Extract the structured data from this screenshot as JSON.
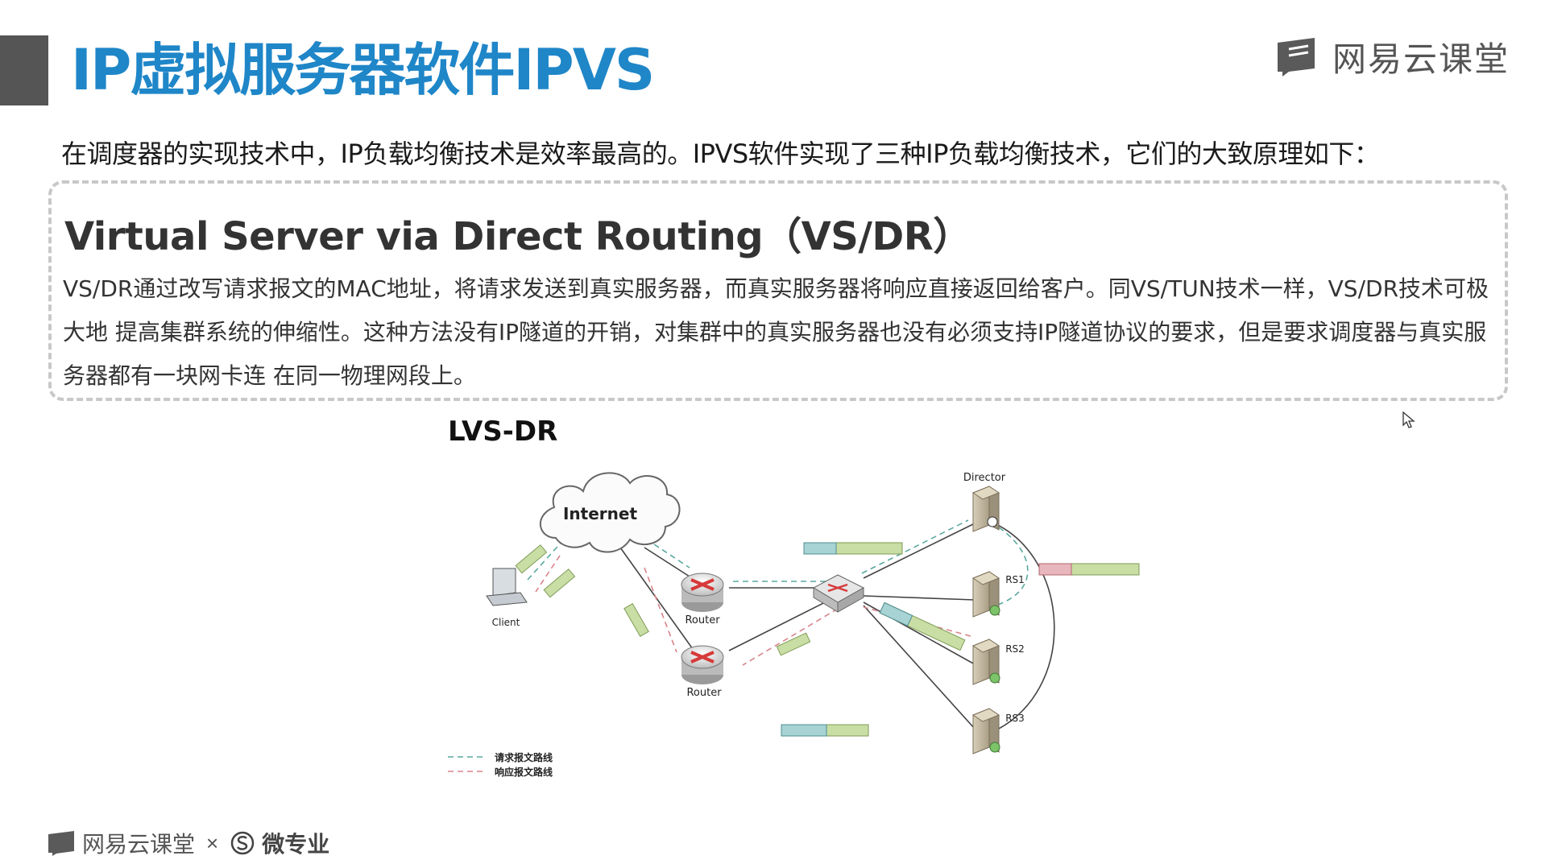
{
  "header": {
    "title": "IP虚拟服务器软件IPVS",
    "brand": "网易云课堂"
  },
  "intro": "在调度器的实现技术中，IP负载均衡技术是效率最高的。IPVS软件实现了三种IP负载均衡技术，它们的大致原理如下：",
  "section": {
    "heading": "Virtual Server via Direct Routing（VS/DR）",
    "body": "VS/DR通过改写请求报文的MAC地址，将请求发送到真实服务器，而真实服务器将响应直接返回给客户。同VS/TUN技术一样，VS/DR技术可极大地 提高集群系统的伸缩性。这种方法没有IP隧道的开销，对集群中的真实服务器也没有必须支持IP隧道协议的要求，但是要求调度器与真实服务器都有一块网卡连 在同一物理网段上。"
  },
  "diagram": {
    "label": "LVS-DR",
    "nodes": {
      "internet": "Internet",
      "client": "Client",
      "router_top": "Router",
      "router_bottom": "Router",
      "director": "Director",
      "rs1": "RS1",
      "rs2": "RS2",
      "rs3": "RS3"
    },
    "legend": {
      "request": "请求报文路线",
      "response": "响应报文路线"
    },
    "colors": {
      "request_line": "#5aa9a0",
      "response_line": "#d9848a",
      "accent": "#1f86c8"
    }
  },
  "footer": {
    "brand": "网易云课堂",
    "separator": "×",
    "partner": "微专业"
  }
}
